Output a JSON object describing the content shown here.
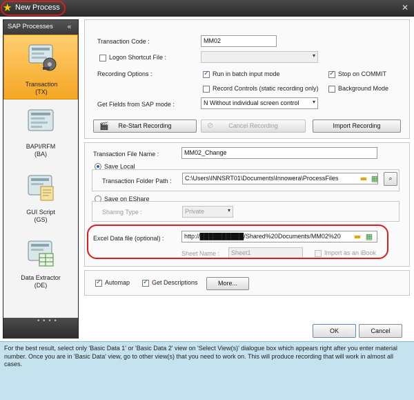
{
  "window": {
    "title": "New Process"
  },
  "sidebar": {
    "header": "SAP Processes",
    "items": [
      {
        "label": "Transaction",
        "sub": "(TX)",
        "icon": "transaction-icon",
        "active": true
      },
      {
        "label": "BAPI/RFM",
        "sub": "(BA)",
        "icon": "bapi-icon",
        "active": false
      },
      {
        "label": "GUI Script",
        "sub": "(GS)",
        "icon": "gui-script-icon",
        "active": false
      },
      {
        "label": "Data Extractor",
        "sub": "(DE)",
        "icon": "data-extractor-icon",
        "active": false
      }
    ]
  },
  "recording": {
    "transaction_code_label": "Transaction Code :",
    "transaction_code_value": "MM02",
    "logon_shortcut_label": "Logon Shortcut File :",
    "recording_options_label": "Recording Options  :",
    "run_batch_label": "Run in batch input mode",
    "stop_commit_label": "Stop on COMMIT",
    "record_controls_label": "Record Controls (static recording only)",
    "background_mode_label": "Background Mode",
    "get_fields_label": "Get Fields from SAP mode :",
    "get_fields_value": "N Without individual screen control",
    "restart_button": "Re-Start Recording",
    "cancel_button": "Cancel Recording",
    "import_button": "Import Recording"
  },
  "file": {
    "transaction_file_label": "Transaction File Name  :",
    "transaction_file_value": "MM02_Change",
    "save_local_label": "Save Local",
    "folder_path_label": "Transaction Folder Path :",
    "folder_path_value": "C:\\Users\\INNSRT01\\Documents\\Innowera\\ProcessFiles",
    "save_eshare_label": "Save on EShare",
    "sharing_type_label": "Sharing Type :",
    "sharing_type_value": "Private",
    "excel_label": "Excel Data file (optional)  :",
    "excel_value": "http://██████████/Shared%20Documents/MM02%20",
    "sheet_name_label": "Sheet Name :",
    "sheet_name_value": "Sheet1",
    "import_ibook_label": "Import as an iBook"
  },
  "options": {
    "automap_label": "Automap",
    "get_descriptions_label": "Get Descriptions",
    "more_button": "More..."
  },
  "footer": {
    "ok_button": "OK",
    "cancel_button": "Cancel"
  },
  "info": {
    "text": "For the best result, select only 'Basic Data 1' or 'Basic Data 2' view on 'Select View(s)' dialogue box which appears right after you enter material number. Once you are in 'Basic Data' view, go to other view(s) that you need to work on. This will produce recording that will work in almost all cases."
  }
}
